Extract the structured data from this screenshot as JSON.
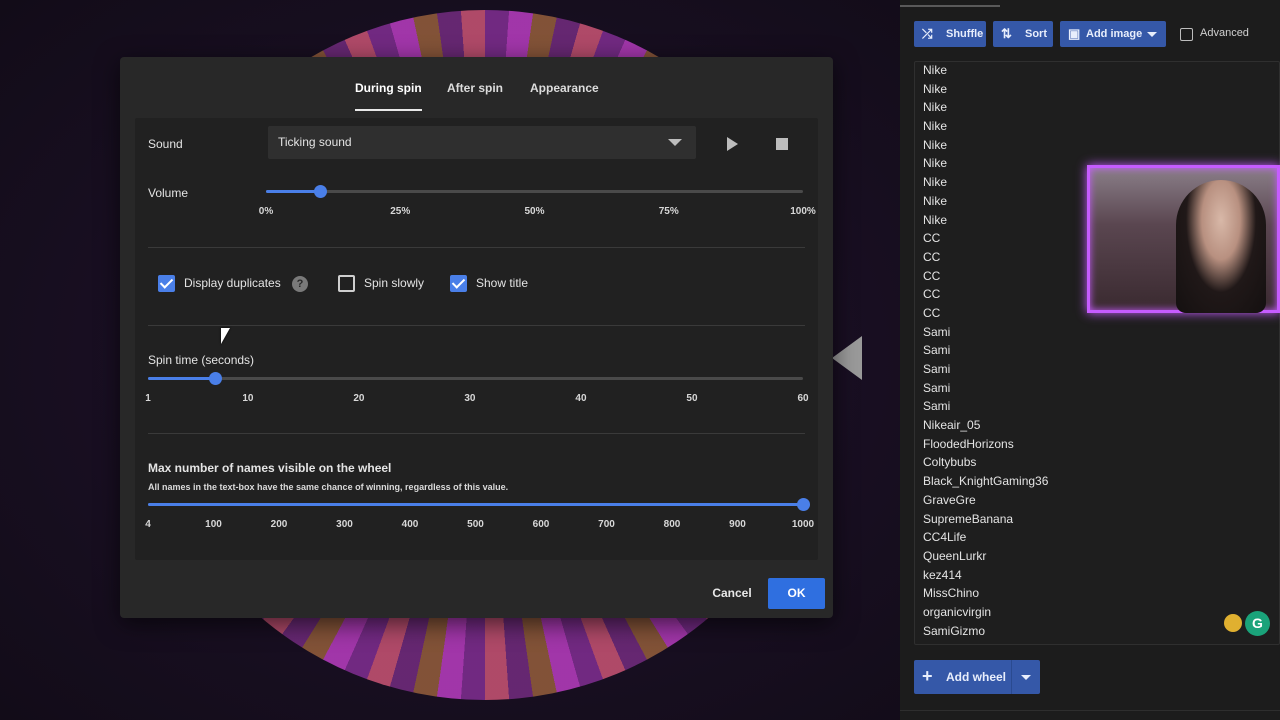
{
  "dialog": {
    "tabs": [
      {
        "label": "During spin",
        "active": true
      },
      {
        "label": "After spin",
        "active": false
      },
      {
        "label": "Appearance",
        "active": false
      }
    ],
    "sound": {
      "label": "Sound",
      "selected": "Ticking sound",
      "play_icon": "play-icon",
      "stop_icon": "stop-icon"
    },
    "volume": {
      "label": "Volume",
      "value_percent": 10,
      "ticks": [
        "0%",
        "25%",
        "50%",
        "75%",
        "100%"
      ]
    },
    "options": {
      "display_duplicates": {
        "label": "Display duplicates",
        "checked": true,
        "help_icon": "?"
      },
      "spin_slowly": {
        "label": "Spin slowly",
        "checked": false
      },
      "show_title": {
        "label": "Show title",
        "checked": true
      }
    },
    "spin_time": {
      "label": "Spin time (seconds)",
      "value": 7,
      "min": 1,
      "max": 60,
      "ticks": [
        "1",
        "10",
        "20",
        "30",
        "40",
        "50",
        "60"
      ]
    },
    "max_names": {
      "label": "Max number of names visible on the wheel",
      "description": "All names in the text-box have the same chance of winning, regardless of this value.",
      "value": 1000,
      "min": 4,
      "max": 1000,
      "ticks": [
        "4",
        "100",
        "200",
        "300",
        "400",
        "500",
        "600",
        "700",
        "800",
        "900",
        "1000"
      ]
    },
    "buttons": {
      "cancel": "Cancel",
      "ok": "OK"
    }
  },
  "right_panel": {
    "toolbar": {
      "shuffle": "Shuffle",
      "sort": "Sort",
      "add_image": "Add image",
      "advanced": "Advanced"
    },
    "names": [
      "Nike",
      "Nike",
      "Nike",
      "Nike",
      "Nike",
      "Nike",
      "Nike",
      "Nike",
      "Nike",
      "CC",
      "CC",
      "CC",
      "CC",
      "CC",
      "Sami",
      "Sami",
      "Sami",
      "Sami",
      "Sami",
      "Nikeair_05",
      "FloodedHorizons",
      "Coltybubs",
      "Black_KnightGaming36",
      "GraveGre",
      "SupremeBanana",
      "CC4Life",
      "QueenLurkr",
      "kez414",
      "MissChino",
      "organicvirgin",
      "SamiGizmo"
    ],
    "add_wheel": "Add wheel"
  },
  "colors": {
    "accent": "#4a7fe8",
    "ok_button": "#2f6fe0",
    "toolbar_button": "#3558a8",
    "webcam_border": "#c65cff"
  }
}
